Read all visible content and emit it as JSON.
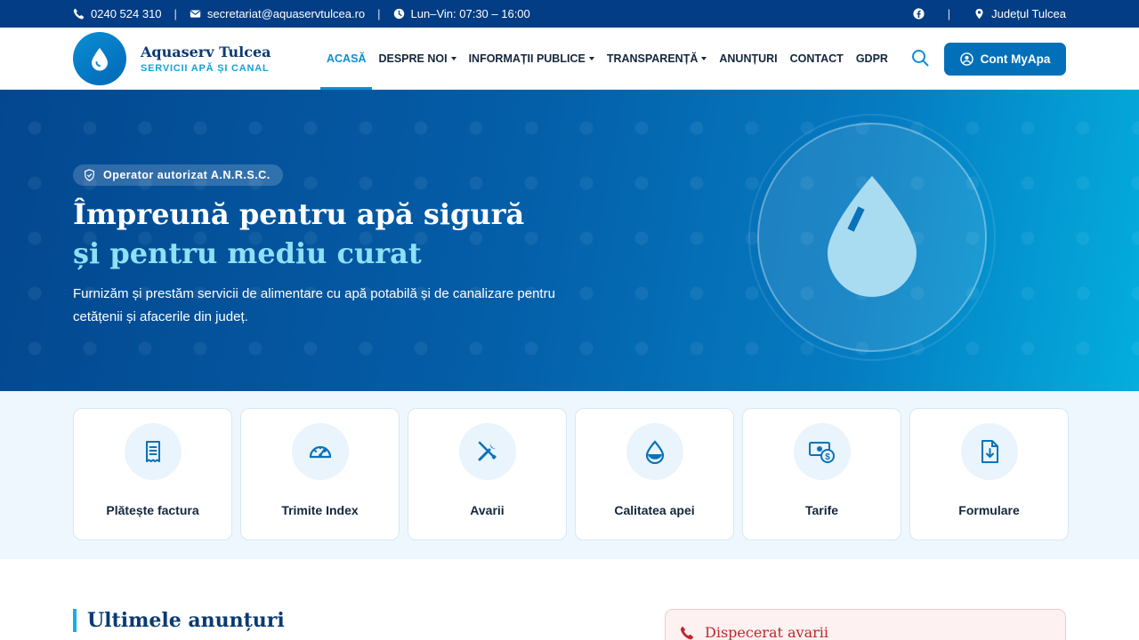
{
  "topbar": {
    "phone": "0240 524 310",
    "email": "secretariat@aquaservtulcea.ro",
    "hours": "Lun–Vin: 07:30 – 16:00",
    "separator": "|",
    "region": "Județul Tulcea"
  },
  "brand": {
    "name": "Aquaserv Tulcea",
    "tagline": "SERVICII APĂ ȘI CANAL"
  },
  "nav": {
    "items": [
      {
        "label": "ACASĂ",
        "active": true,
        "dropdown": false
      },
      {
        "label": "DESPRE NOI",
        "active": false,
        "dropdown": true
      },
      {
        "label": "INFORMAȚII PUBLICE",
        "active": false,
        "dropdown": true
      },
      {
        "label": "TRANSPARENȚĂ",
        "active": false,
        "dropdown": true
      },
      {
        "label": "ANUNȚURI",
        "active": false,
        "dropdown": false
      },
      {
        "label": "CONTACT",
        "active": false,
        "dropdown": false
      },
      {
        "label": "GDPR",
        "active": false,
        "dropdown": false
      }
    ],
    "account_button": "Cont MyApa"
  },
  "hero": {
    "badge": "Operator autorizat A.N.R.S.C.",
    "title_line1": "Împreună pentru apă sigură",
    "title_line2": "și pentru mediu curat",
    "description": "Furnizăm și prestăm servicii de alimentare cu apă potabilă și de canalizare pentru cetățenii și afacerile din județ."
  },
  "quick_links": [
    {
      "label": "Plătește factura",
      "icon": "invoice-icon"
    },
    {
      "label": "Trimite Index",
      "icon": "gauge-icon"
    },
    {
      "label": "Avarii",
      "icon": "tools-icon"
    },
    {
      "label": "Calitatea apei",
      "icon": "water-drop-icon"
    },
    {
      "label": "Tarife",
      "icon": "money-icon"
    },
    {
      "label": "Formulare",
      "icon": "file-download-icon"
    }
  ],
  "announcements": {
    "title": "Ultimele anunțuri"
  },
  "dispatch": {
    "title": "Dispecerat avarii"
  },
  "colors": {
    "topbar": "#023d85",
    "primary": "#0270b9",
    "accent": "#0a8fd4",
    "hero_accent_text": "#8fe0f6",
    "alert": "#c0262d"
  }
}
